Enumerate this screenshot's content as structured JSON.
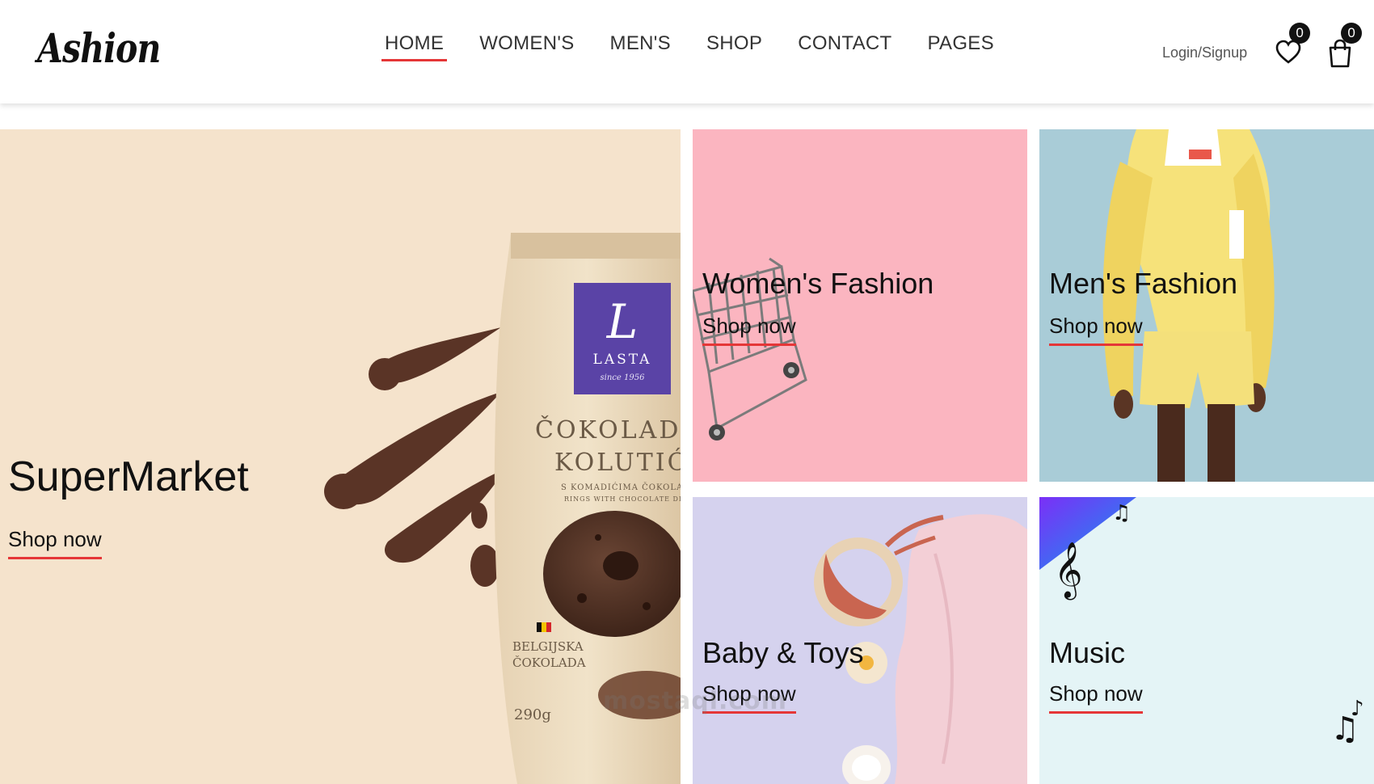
{
  "brand": {
    "logo": "Ashion"
  },
  "nav": {
    "items": [
      {
        "label": "HOME",
        "active": true
      },
      {
        "label": "WOMEN'S",
        "active": false
      },
      {
        "label": "MEN'S",
        "active": false
      },
      {
        "label": "SHOP",
        "active": false
      },
      {
        "label": "CONTACT",
        "active": false
      },
      {
        "label": "PAGES",
        "active": false
      }
    ]
  },
  "header_actions": {
    "login_label": "Login/Signup",
    "wishlist_count": "0",
    "cart_count": "0"
  },
  "categories": {
    "supermarket": {
      "title": "SuperMarket",
      "link": "Shop now"
    },
    "womens": {
      "title": "Women's Fashion",
      "link": "Shop now"
    },
    "mens": {
      "title": "Men's Fashion",
      "link": "Shop now"
    },
    "baby": {
      "title": "Baby & Toys",
      "link": "Shop now"
    },
    "music": {
      "title": "Music",
      "link": "Shop now"
    }
  },
  "product_pack": {
    "brand_letter": "L",
    "brand_name": "LASTA",
    "brand_since": "since 1956",
    "name_line1": "ČOKOLADNI",
    "name_line2": "KOLUTIĆI",
    "subtitle_line1": "S KOMADIĆIMA ČOKOLADE",
    "subtitle_line2": "RINGS WITH CHOCOLATE DROPS",
    "origin_line1": "BELGIJSKA",
    "origin_line2": "ČOKOLADA",
    "weight": "290g"
  },
  "watermark": "mostaql.com",
  "colors": {
    "accent": "#e53637",
    "supermarket_bg": "#f5e3cc",
    "womens_bg": "#fbb5c0",
    "mens_bg": "#a9ccd7",
    "baby_bg": "#d5d2ee",
    "music_bg": "#e4f4f6"
  },
  "icons": [
    "heart-icon",
    "shopping-bag-icon"
  ]
}
